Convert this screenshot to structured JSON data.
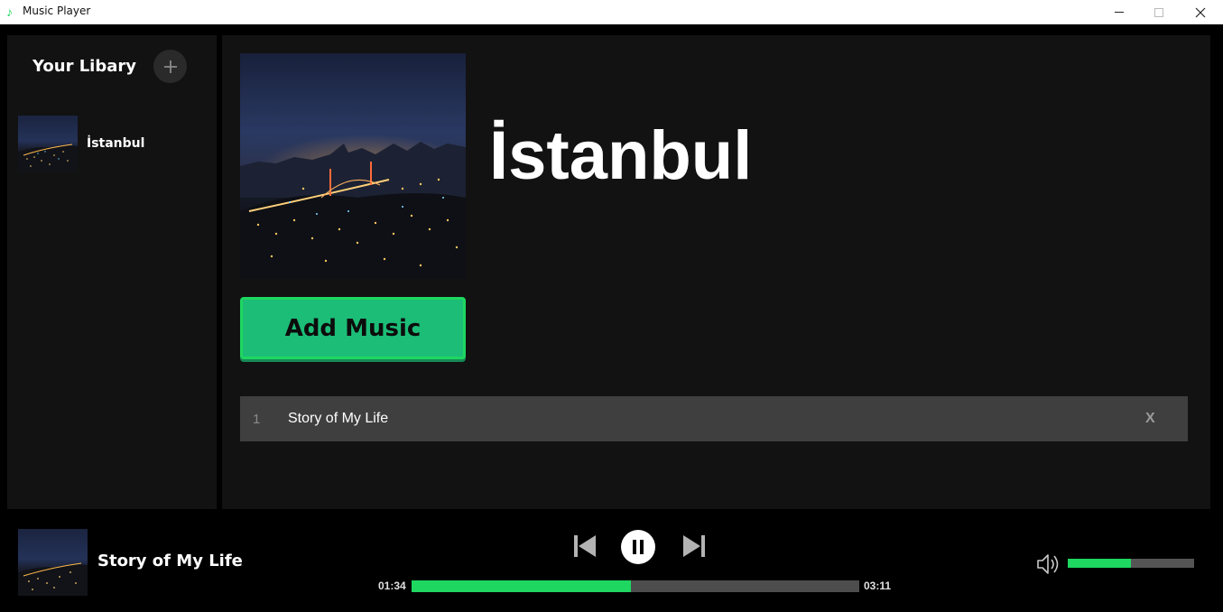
{
  "window": {
    "title": "Music Player",
    "icon": "music-note-icon"
  },
  "sidebar": {
    "title": "Your Libary",
    "add_icon": "plus-icon",
    "items": [
      {
        "label": "İstanbul"
      }
    ]
  },
  "playlist": {
    "title": "İstanbul",
    "add_music_label": "Add Music",
    "tracks": [
      {
        "number": "1",
        "title": "Story of My Life",
        "remove_label": "X"
      }
    ]
  },
  "player": {
    "now_playing": "Story of My Life",
    "current_time": "01:34",
    "total_time": "03:11",
    "progress": 0.49,
    "volume": 0.5,
    "state": "playing"
  },
  "colors": {
    "accent": "#1ed760",
    "button": "#1cbd77",
    "panel": "#121212",
    "row": "#3f3f3f"
  }
}
